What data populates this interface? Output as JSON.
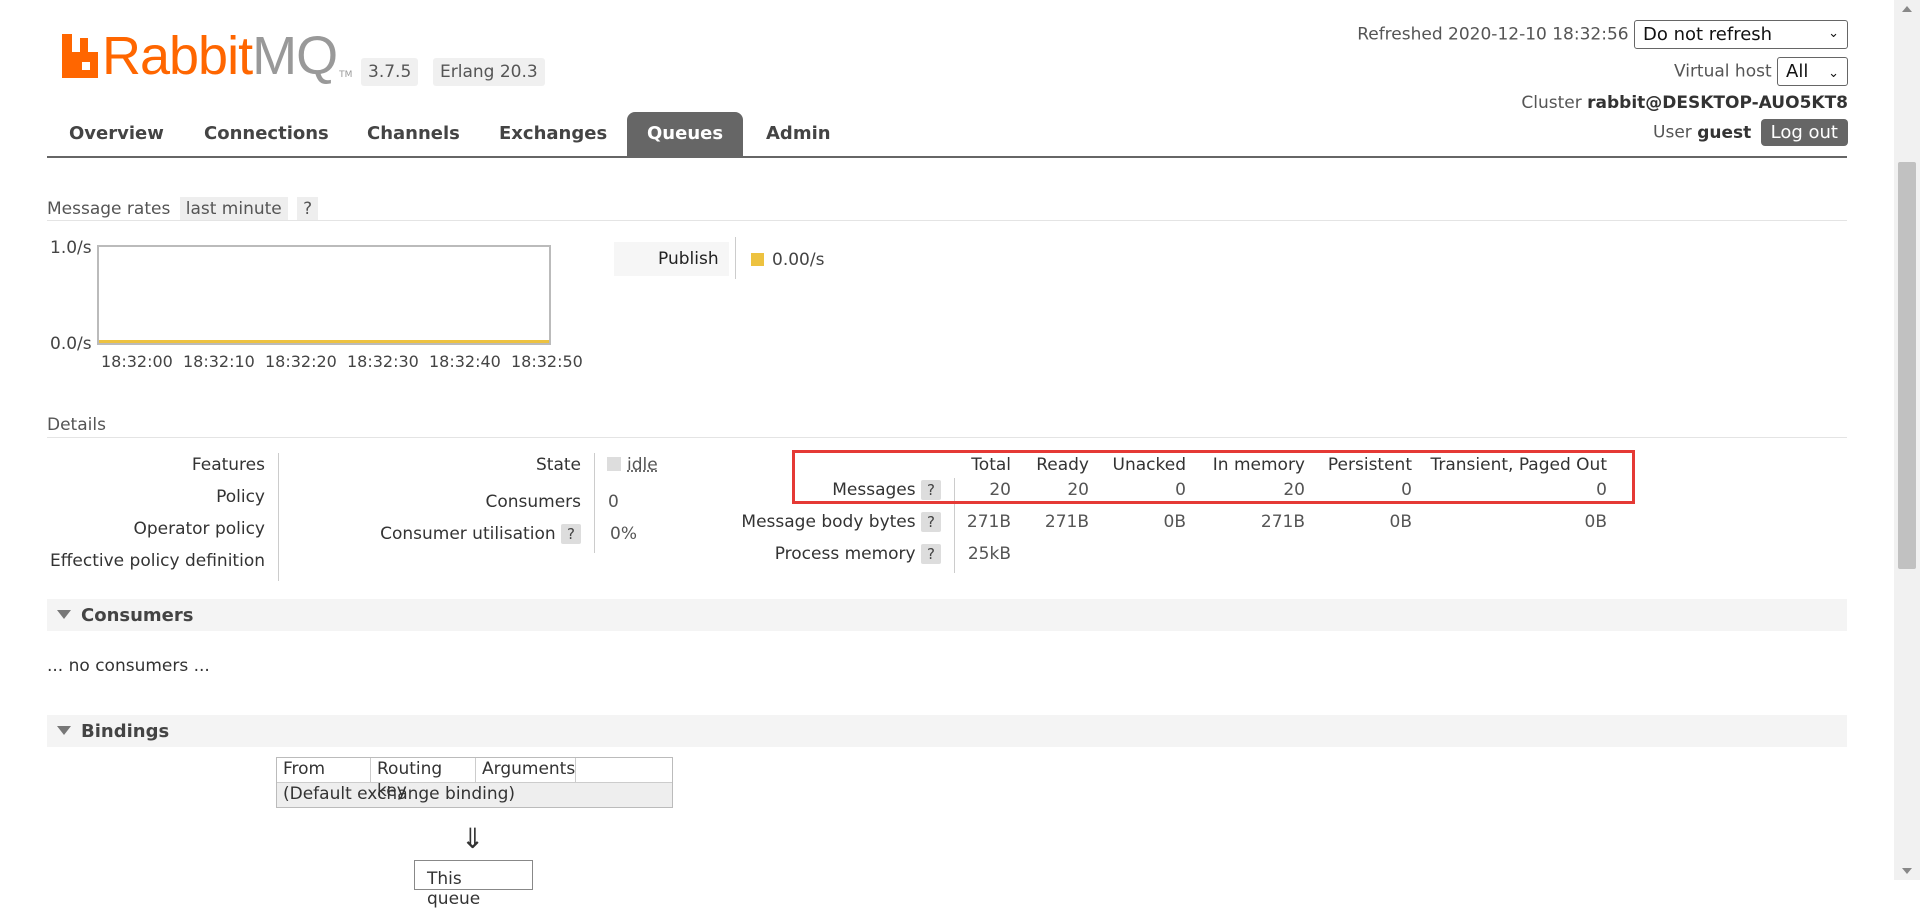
{
  "header": {
    "logo_rabbit": "Rabbit",
    "logo_mq": "MQ",
    "logo_tm": "TM",
    "version": "3.7.5",
    "erlang": "Erlang 20.3",
    "refreshed_label": "Refreshed 2020-12-10 18:32:56",
    "refresh_select": "Do not refresh",
    "vhost_label": "Virtual host",
    "vhost_select": "All",
    "cluster_label": "Cluster",
    "cluster_name": "rabbit@DESKTOP-AUO5KT8",
    "user_label": "User",
    "user_name": "guest",
    "logout": "Log out"
  },
  "nav": {
    "tabs": [
      "Overview",
      "Connections",
      "Channels",
      "Exchanges",
      "Queues",
      "Admin"
    ],
    "active": "Queues"
  },
  "rates": {
    "label": "Message rates",
    "period": "last minute",
    "help": "?",
    "y_max": "1.0/s",
    "y_min": "0.0/s",
    "x_ticks": [
      "18:32:00",
      "18:32:10",
      "18:32:20",
      "18:32:30",
      "18:32:40",
      "18:32:50"
    ],
    "legend_label": "Publish",
    "legend_value": "0.00/s",
    "legend_color": "#edc240"
  },
  "details": {
    "label": "Details",
    "features": "Features",
    "policy": "Policy",
    "operator_policy": "Operator policy",
    "effective_policy": "Effective policy definition",
    "state_label": "State",
    "state_value": "idle",
    "consumers_label": "Consumers",
    "consumers_value": "0",
    "utilisation_label": "Consumer utilisation",
    "utilisation_value": "0%"
  },
  "stats": {
    "headers": [
      "Total",
      "Ready",
      "Unacked",
      "In memory",
      "Persistent",
      "Transient, Paged Out"
    ],
    "messages_label": "Messages",
    "messages": [
      "20",
      "20",
      "0",
      "20",
      "0",
      "0"
    ],
    "body_bytes_label": "Message body bytes",
    "body_bytes": [
      "271B",
      "271B",
      "0B",
      "271B",
      "0B",
      "0B"
    ],
    "process_memory_label": "Process memory",
    "process_memory": "25kB"
  },
  "consumers_section": {
    "title": "Consumers",
    "empty": "... no consumers ..."
  },
  "bindings_section": {
    "title": "Bindings",
    "columns": [
      "From",
      "Routing key",
      "Arguments"
    ],
    "default_binding": "(Default exchange binding)",
    "arrow": "⇓",
    "this_queue": "This queue"
  }
}
